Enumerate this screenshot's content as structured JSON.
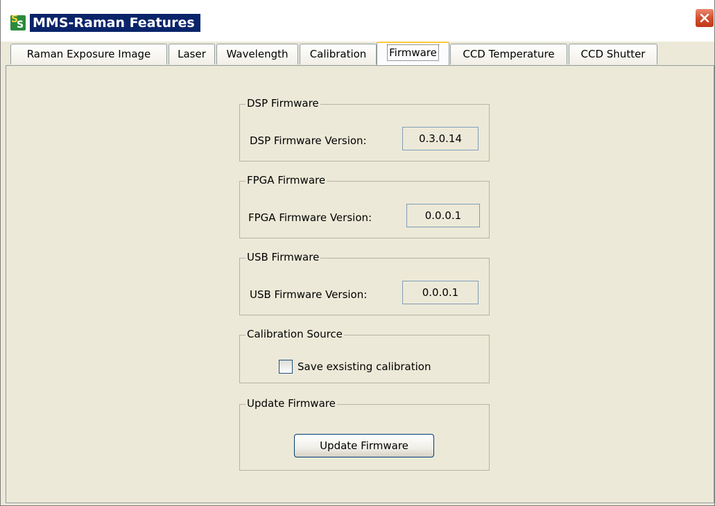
{
  "window": {
    "title": "MMS-Raman Features",
    "icon": "app-logo-icon",
    "close_icon": "close-icon"
  },
  "tabs": [
    {
      "label": "Raman Exposure Image",
      "active": false
    },
    {
      "label": "Laser",
      "active": false
    },
    {
      "label": "Wavelength",
      "active": false
    },
    {
      "label": "Calibration",
      "active": false
    },
    {
      "label": "Firmware",
      "active": true
    },
    {
      "label": "CCD Temperature",
      "active": false
    },
    {
      "label": "CCD Shutter",
      "active": false
    }
  ],
  "firmware": {
    "dsp": {
      "group_title": "DSP Firmware",
      "label": "DSP Firmware Version:",
      "value": "0.3.0.14"
    },
    "fpga": {
      "group_title": "FPGA Firmware",
      "label": "FPGA Firmware Version:",
      "value": "0.0.0.1"
    },
    "usb": {
      "group_title": "USB Firmware",
      "label": "USB Firmware Version:",
      "value": "0.0.0.1"
    },
    "calibration": {
      "group_title": "Calibration Source",
      "checkbox_label": "Save exsisting calibration",
      "checked": false
    },
    "update": {
      "group_title": "Update Firmware",
      "button_label": "Update Firmware"
    }
  },
  "colors": {
    "title_highlight": "#0a246a",
    "panel_bg": "#ece9d8",
    "active_tab_accent": "#ffc83c",
    "close_button": "#d24b2a"
  }
}
